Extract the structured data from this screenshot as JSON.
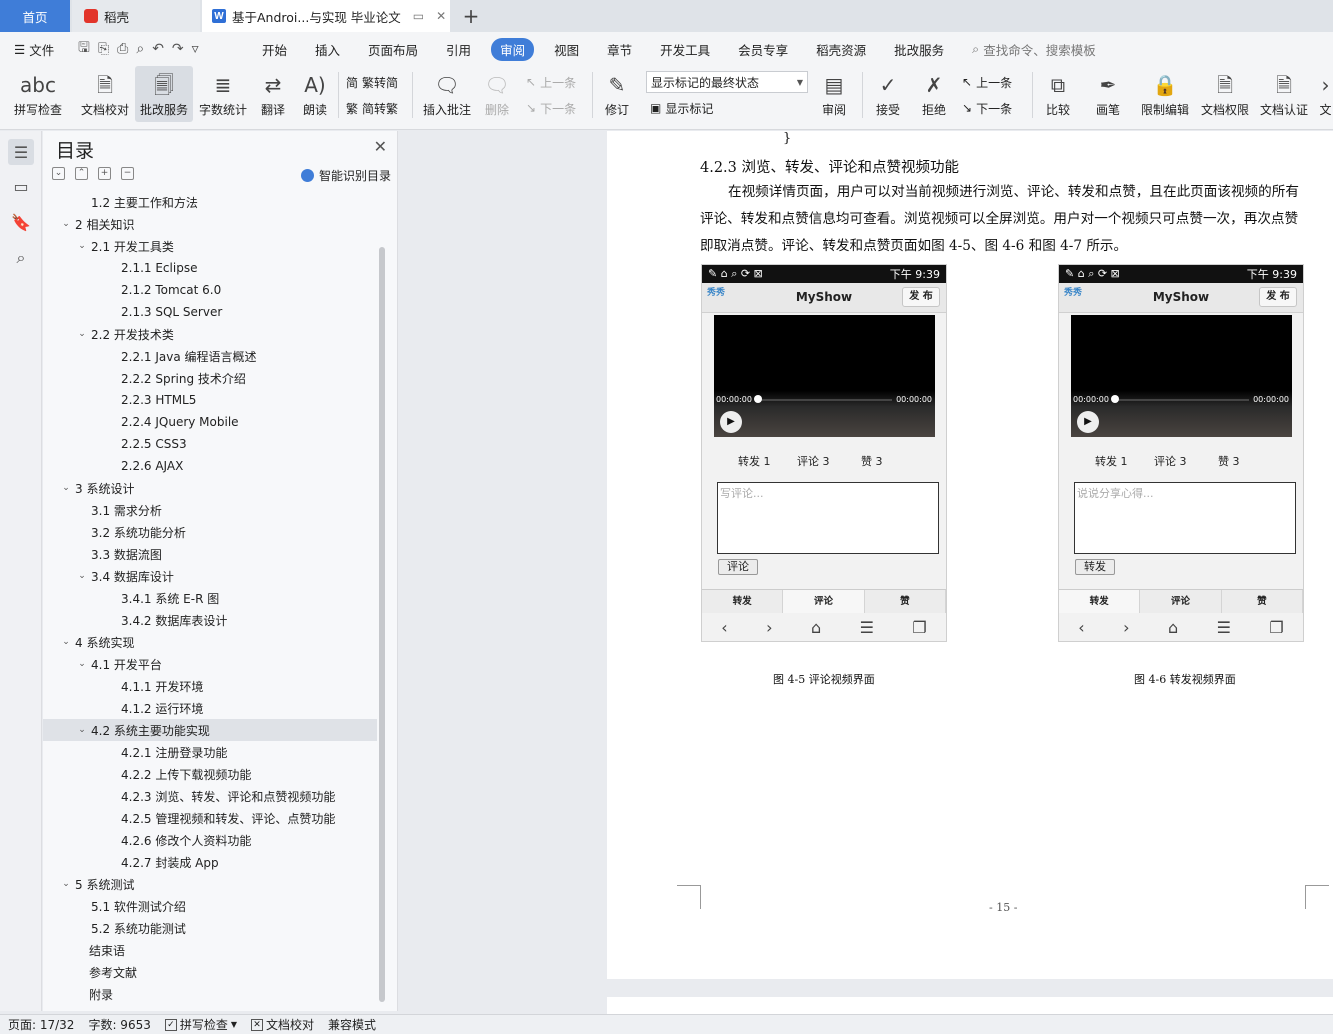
{
  "tabs": {
    "home": "首页",
    "daoke": "稻壳",
    "document": "基于Androi...与实现 毕业论文",
    "new_tab": "+"
  },
  "menu": {
    "file": "文件",
    "items": [
      "开始",
      "插入",
      "页面布局",
      "引用",
      "审阅",
      "视图",
      "章节",
      "开发工具",
      "会员专享",
      "稻壳资源",
      "批改服务"
    ],
    "active": "审阅",
    "search_placeholder": "查找命令、搜索模板"
  },
  "ribbon": {
    "spell_check": "拼写检查",
    "doc_proofread": "文档校对",
    "correction_service": "批改服务",
    "word_count": "字数统计",
    "translate": "翻译",
    "read_aloud": "朗读",
    "trad_to_simp": "繁转简",
    "simp_to_trad": "简转繁",
    "insert_comment": "插入批注",
    "delete": "删除",
    "prev_comment": "上一条",
    "next_comment": "下一条",
    "track_changes": "修订",
    "markup_select": "显示标记的最终状态",
    "show_markup": "显示标记",
    "review": "审阅",
    "accept": "接受",
    "reject": "拒绝",
    "prev_change": "上一条",
    "next_change": "下一条",
    "compare": "比较",
    "pen": "画笔",
    "restrict_edit": "限制编辑",
    "doc_permission": "文档权限",
    "doc_cert": "文档认证",
    "overflow": "文"
  },
  "toc": {
    "title": "目录",
    "smart": "智能识别目录",
    "items": [
      {
        "label": "1.2 主要工作和方法",
        "level": 2,
        "chev": ""
      },
      {
        "label": "2  相关知识",
        "level": 1,
        "chev": "v"
      },
      {
        "label": "2.1 开发工具类",
        "level": 2,
        "chev": "v"
      },
      {
        "label": "2.1.1 Eclipse",
        "level": 3,
        "chev": ""
      },
      {
        "label": "2.1.2 Tomcat 6.0",
        "level": 3,
        "chev": ""
      },
      {
        "label": "2.1.3 SQL Server",
        "level": 3,
        "chev": ""
      },
      {
        "label": "2.2 开发技术类",
        "level": 2,
        "chev": "v"
      },
      {
        "label": "2.2.1 Java 编程语言概述",
        "level": 3,
        "chev": ""
      },
      {
        "label": "2.2.2 Spring 技术介绍",
        "level": 3,
        "chev": ""
      },
      {
        "label": "2.2.3 HTML5",
        "level": 3,
        "chev": ""
      },
      {
        "label": "2.2.4 JQuery Mobile",
        "level": 3,
        "chev": ""
      },
      {
        "label": "2.2.5 CSS3",
        "level": 3,
        "chev": ""
      },
      {
        "label": "2.2.6 AJAX",
        "level": 3,
        "chev": ""
      },
      {
        "label": "3  系统设计",
        "level": 1,
        "chev": "v"
      },
      {
        "label": "3.1 需求分析",
        "level": 2,
        "chev": ""
      },
      {
        "label": "3.2 系统功能分析",
        "level": 2,
        "chev": ""
      },
      {
        "label": "3.3 数据流图",
        "level": 2,
        "chev": ""
      },
      {
        "label": "3.4 数据库设计",
        "level": 2,
        "chev": "v"
      },
      {
        "label": "3.4.1 系统 E-R 图",
        "level": 3,
        "chev": ""
      },
      {
        "label": "3.4.2 数据库表设计",
        "level": 3,
        "chev": ""
      },
      {
        "label": "4  系统实现",
        "level": 1,
        "chev": "v"
      },
      {
        "label": "4.1 开发平台",
        "level": 2,
        "chev": "v"
      },
      {
        "label": "4.1.1 开发环境",
        "level": 3,
        "chev": ""
      },
      {
        "label": "4.1.2 运行环境",
        "level": 3,
        "chev": ""
      },
      {
        "label": "4.2 系统主要功能实现",
        "level": 2,
        "chev": "v",
        "selected": true
      },
      {
        "label": "4.2.1 注册登录功能",
        "level": 3,
        "chev": ""
      },
      {
        "label": "4.2.2 上传下载视频功能",
        "level": 3,
        "chev": ""
      },
      {
        "label": "4.2.3 浏览、转发、评论和点赞视频功能",
        "level": 3,
        "chev": ""
      },
      {
        "label": "4.2.5 管理视频和转发、评论、点赞功能",
        "level": 3,
        "chev": ""
      },
      {
        "label": "4.2.6 修改个人资料功能",
        "level": 3,
        "chev": ""
      },
      {
        "label": "4.2.7 封装成 App",
        "level": 3,
        "chev": ""
      },
      {
        "label": "5  系统测试",
        "level": 1,
        "chev": "v"
      },
      {
        "label": "5.1 软件测试介绍",
        "level": 2,
        "chev": ""
      },
      {
        "label": "5.2 系统功能测试",
        "level": 2,
        "chev": ""
      },
      {
        "label": "结束语",
        "level": 0,
        "chev": ""
      },
      {
        "label": "参考文献",
        "level": 0,
        "chev": ""
      },
      {
        "label": "附录",
        "level": 0,
        "chev": ""
      }
    ]
  },
  "document": {
    "brace": "}",
    "heading": "4.2.3 浏览、转发、评论和点赞视频功能",
    "paragraph": "在视频详情页面，用户可以对当前视频进行浏览、评论、转发和点赞，且在此页面该视频的所有评论、转发和点赞信息均可查看。浏览视频可以全屏浏览。用户对一个视频只可点赞一次，再次点赞即取消点赞。评论、转发和点赞页面如图 4-5、图 4-6 和图 4-7 所示。",
    "caption_left": "图 4-5  评论视频界面",
    "caption_right": "图 4-6  转发视频界面",
    "page_number": "- 15 -"
  },
  "phones": [
    {
      "status_time": "下午 9:39",
      "brand": "秀秀",
      "title": "MyShow",
      "publish": "发 布",
      "time_start": "00:00:00",
      "time_end": "00:00:00",
      "forward": "转发 1",
      "comment": "评论 3",
      "like": "赞 3",
      "placeholder": "写评论...",
      "submit": "评论",
      "tab_forward": "转发",
      "tab_comment": "评论",
      "tab_like": "赞",
      "selected_tab": "评论"
    },
    {
      "status_time": "下午 9:39",
      "brand": "秀秀",
      "title": "MyShow",
      "publish": "发 布",
      "time_start": "00:00:00",
      "time_end": "00:00:00",
      "forward": "转发 1",
      "comment": "评论 3",
      "like": "赞 3",
      "placeholder": "说说分享心得...",
      "submit": "转发",
      "tab_forward": "转发",
      "tab_comment": "评论",
      "tab_like": "赞",
      "selected_tab": "转发"
    }
  ],
  "status": {
    "page": "页面: 17/32",
    "words": "字数: 9653",
    "spell": "拼写检查",
    "proofread": "文档校对",
    "compat": "兼容模式"
  },
  "colors": {
    "accent": "#3f7dd8",
    "selected_row": "#dfe2e7"
  }
}
